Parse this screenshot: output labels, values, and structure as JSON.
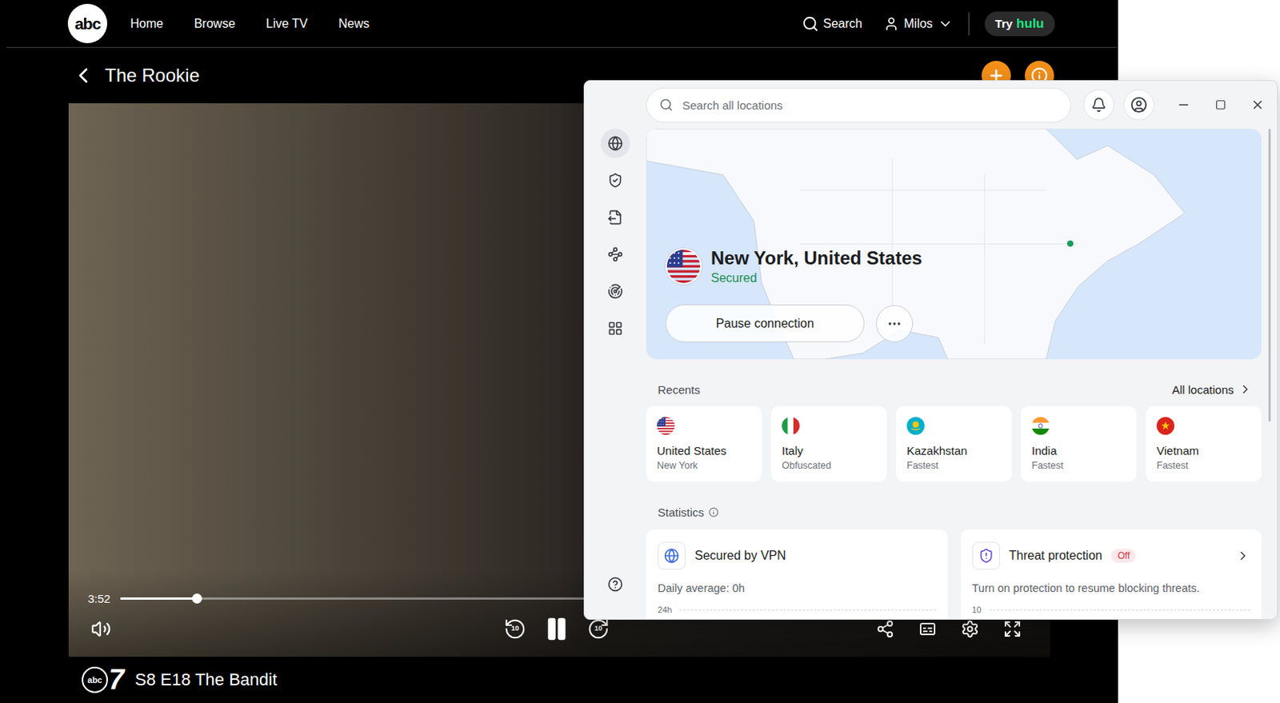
{
  "site": {
    "logo": "abc",
    "nav": [
      {
        "label": "Home"
      },
      {
        "label": "Browse"
      },
      {
        "label": "Live TV"
      },
      {
        "label": "News"
      }
    ],
    "search": "Search",
    "user": "Milos",
    "promo": {
      "prefix": "Try",
      "brand": "hulu"
    }
  },
  "show": {
    "title": "The Rookie"
  },
  "player": {
    "time": "3:52",
    "level": 0.085,
    "playing": true,
    "skip_back": "10",
    "skip_forward": "10"
  },
  "episode": {
    "channel": {
      "brand": "abc",
      "number": "7"
    },
    "title": "S8 E18 The Bandit"
  },
  "vpn": {
    "search": {
      "placeholder": "Search all locations"
    },
    "rail": [
      {
        "selected": true
      },
      {
        "selected": false
      },
      {
        "selected": false
      },
      {
        "selected": false
      },
      {
        "selected": false
      },
      {
        "selected": false
      }
    ],
    "connection": {
      "location": "New York, United States",
      "status": "Secured",
      "connected": true,
      "action": "Pause connection"
    },
    "recents": {
      "title": "Recents",
      "link": "All locations",
      "items": [
        {
          "country": "United States",
          "detail": "New York"
        },
        {
          "country": "Italy",
          "detail": "Obfuscated"
        },
        {
          "country": "Kazakhstan",
          "detail": "Fastest"
        },
        {
          "country": "India",
          "detail": "Fastest"
        },
        {
          "country": "Vietnam",
          "detail": "Fastest"
        }
      ]
    },
    "statistics": {
      "title": "Statistics",
      "cards": [
        {
          "title": "Secured by VPN",
          "badge": "",
          "enabled": true,
          "text": "Daily average: 0h",
          "axis": "24h"
        },
        {
          "title": "Threat protection",
          "badge": "Off",
          "enabled": false,
          "text": "Turn on protection to resume blocking threats.",
          "axis": "10"
        }
      ]
    }
  }
}
